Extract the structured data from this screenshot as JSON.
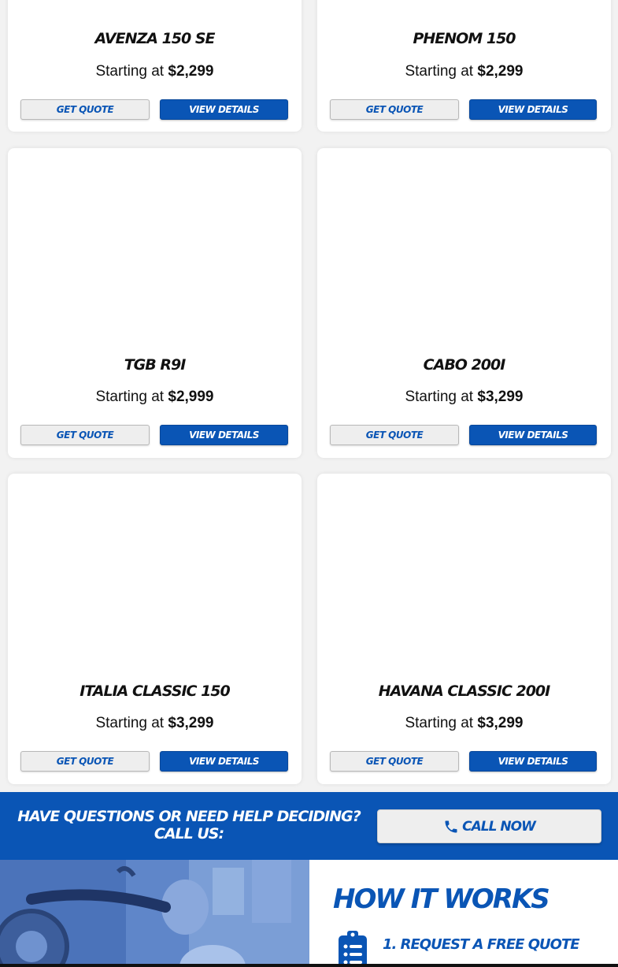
{
  "products": [
    {
      "name": "AVENZA 150 SE",
      "price_prefix": "Starting at",
      "price": "$2,299",
      "quote_label": "GET QUOTE",
      "details_label": "VIEW DETAILS"
    },
    {
      "name": "PHENOM 150",
      "price_prefix": "Starting at",
      "price": "$2,299",
      "quote_label": "GET QUOTE",
      "details_label": "VIEW DETAILS"
    },
    {
      "name": "TGB R9I",
      "price_prefix": "Starting at",
      "price": "$2,999",
      "quote_label": "GET QUOTE",
      "details_label": "VIEW DETAILS"
    },
    {
      "name": "CABO 200I",
      "price_prefix": "Starting at",
      "price": "$3,299",
      "quote_label": "GET QUOTE",
      "details_label": "VIEW DETAILS"
    },
    {
      "name": "ITALIA CLASSIC 150",
      "price_prefix": "Starting at",
      "price": "$3,299",
      "quote_label": "GET QUOTE",
      "details_label": "VIEW DETAILS"
    },
    {
      "name": "HAVANA CLASSIC 200I",
      "price_prefix": "Starting at",
      "price": "$3,299",
      "quote_label": "GET QUOTE",
      "details_label": "VIEW DETAILS"
    }
  ],
  "cta": {
    "line1": "HAVE QUESTIONS OR NEED HELP DECIDING?",
    "line2": "CALL US:",
    "button_label": "CALL NOW",
    "button_icon": "phone-icon"
  },
  "how_it_works": {
    "title": "HOW IT WORKS",
    "steps": [
      {
        "label": "1. REQUEST A FREE QUOTE",
        "icon": "clipboard-list-icon"
      }
    ]
  },
  "colors": {
    "brand_blue": "#0a55b5",
    "page_bg": "#f2f2f2",
    "card_bg": "#ffffff"
  }
}
